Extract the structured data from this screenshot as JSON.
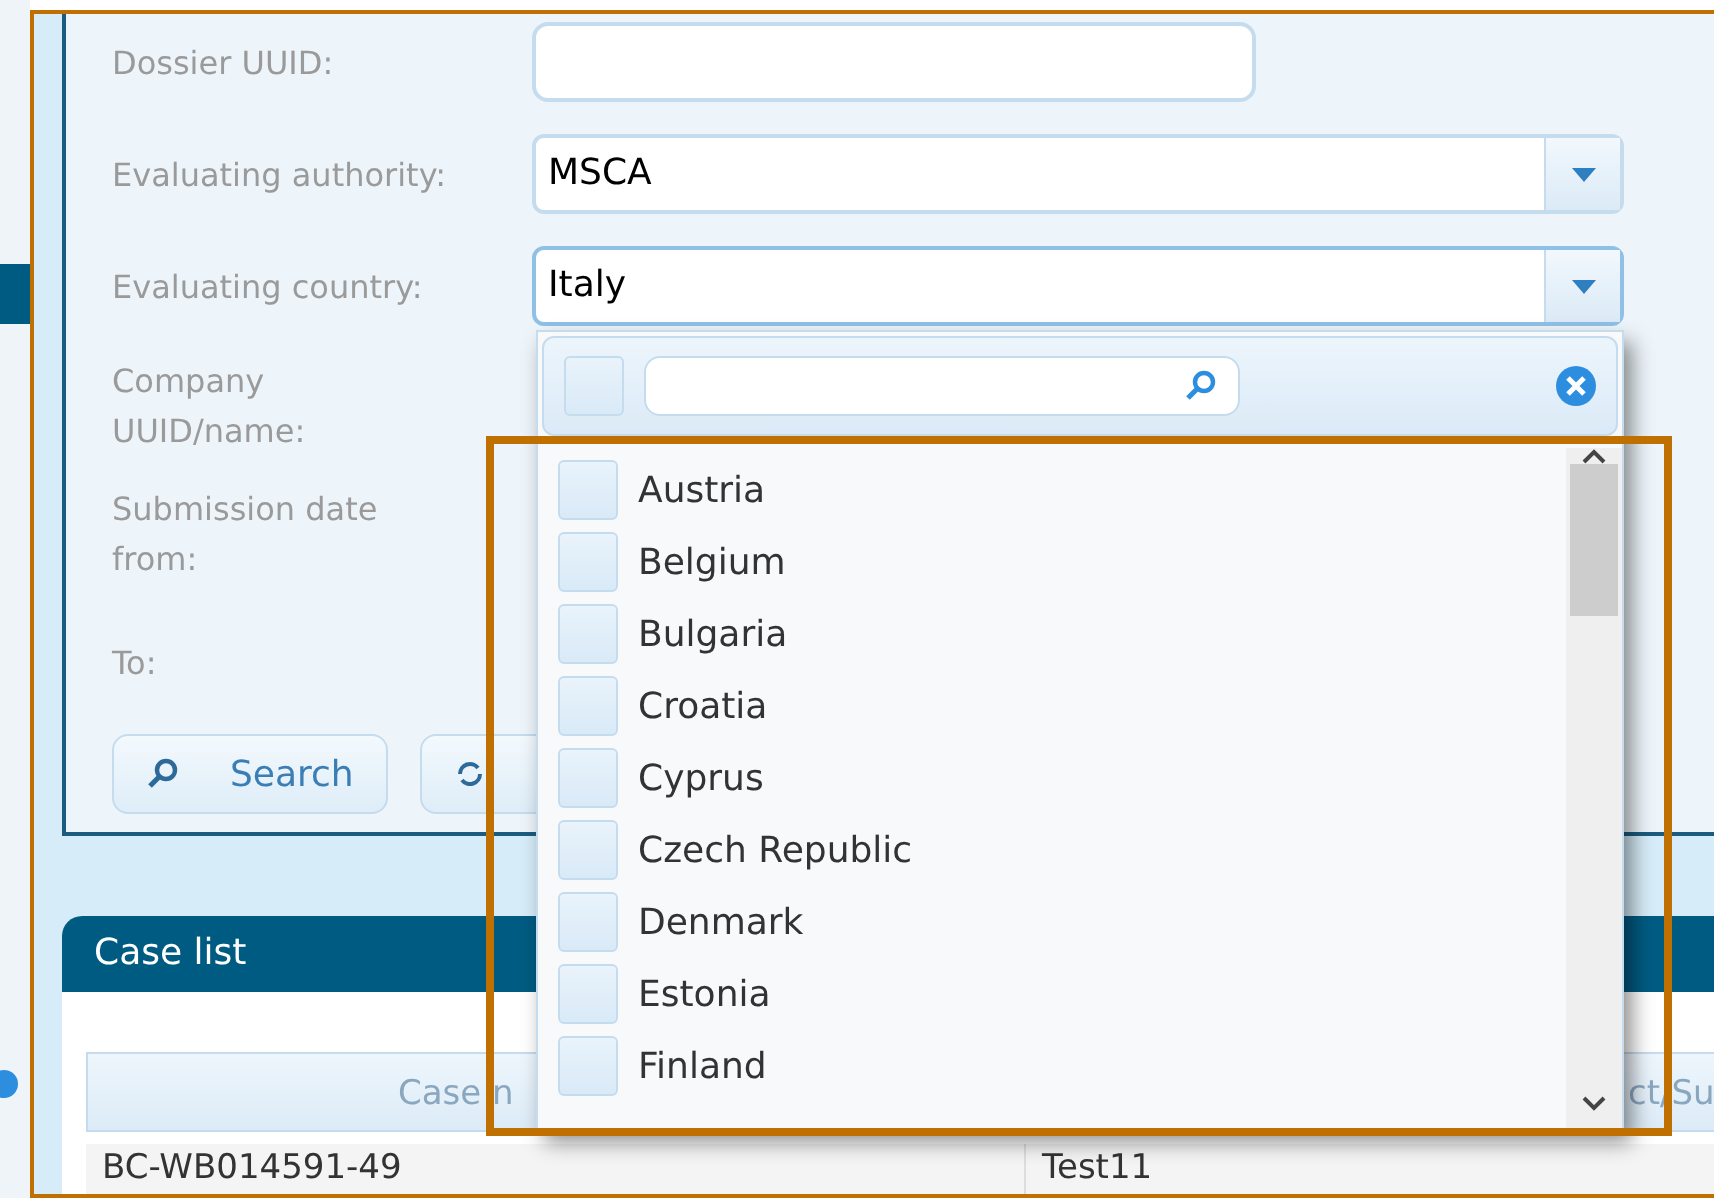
{
  "form": {
    "fields": [
      {
        "kind": "text",
        "label": "Dossier UUID:"
      },
      {
        "kind": "select",
        "label": "Evaluating authority:",
        "value": "MSCA",
        "expanded": false
      },
      {
        "kind": "select",
        "label": "Evaluating country:",
        "value": "Italy",
        "expanded": true
      },
      {
        "kind": "hidden",
        "label": "Company UUID/name:"
      },
      {
        "kind": "hidden",
        "label": "Submission date from:"
      },
      {
        "kind": "hidden",
        "label": "To:"
      }
    ],
    "buttons": [
      {
        "kind": "search",
        "label": "Search"
      },
      {
        "kind": "reset"
      }
    ]
  },
  "dropdown": {
    "select_all_checked": false,
    "items": [
      {
        "label": "Austria",
        "checked": false
      },
      {
        "label": "Belgium",
        "checked": false
      },
      {
        "label": "Bulgaria",
        "checked": false
      },
      {
        "label": "Croatia",
        "checked": false
      },
      {
        "label": "Cyprus",
        "checked": false
      },
      {
        "label": "Czech Republic",
        "checked": false
      },
      {
        "label": "Denmark",
        "checked": false
      },
      {
        "label": "Estonia",
        "checked": false
      },
      {
        "label": "Finland",
        "checked": false
      }
    ]
  },
  "case_list": {
    "title": "Case list",
    "columns": [
      "Case n",
      "ct/Su"
    ],
    "rows": [
      [
        "BC-WB014591-49",
        "Test11"
      ]
    ]
  }
}
